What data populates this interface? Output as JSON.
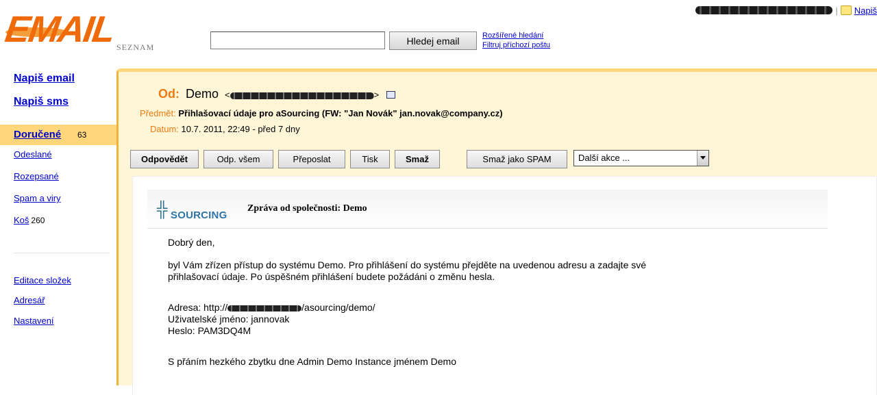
{
  "header": {
    "logo_text": "EMAIL",
    "logo_sub": "SEZNAM",
    "search_placeholder": "",
    "search_button": "Hledej email",
    "advanced_search": "Rozšířené hledání",
    "filter_incoming": "Filtruj příchozí poštu",
    "user_email": "",
    "write_link": "Napiš"
  },
  "sidebar": {
    "compose_email": "Napiš email",
    "compose_sms": "Napiš sms",
    "folders": [
      {
        "name": "Doručené",
        "count": "63"
      },
      {
        "name": "Odeslané",
        "count": ""
      },
      {
        "name": "Rozepsané",
        "count": ""
      },
      {
        "name": "Spam a viry",
        "count": ""
      },
      {
        "name": "Koš",
        "count": "260"
      }
    ],
    "tools": [
      "Editace složek",
      "Adresář",
      "Nastavení"
    ]
  },
  "message": {
    "from_label": "Od:",
    "from_name": "Demo",
    "subject_label": "Předmět:",
    "subject": "Přihlašovací údaje pro aSourcing (FW: \"Jan Novák\" jan.novak@company.cz)",
    "date_label": "Datum:",
    "date": "10.7. 2011, 22:49 - před 7 dny"
  },
  "actions": {
    "reply": "Odpovědět",
    "reply_all": "Odp. všem",
    "forward": "Přeposlat",
    "print": "Tisk",
    "delete": "Smaž",
    "delete_spam": "Smaž jako SPAM",
    "more_actions": "Další akce ..."
  },
  "content": {
    "brand": "SOURCING",
    "company_title": "Zpráva od společnosti: Demo",
    "greeting": "Dobrý den,",
    "para1_line1": "byl Vám zřízen přístup do systému Demo. Pro přihlášení do systému přejděte na uvedenou adresu a zadajte své",
    "para1_line2": "přihlašovací údaje. Po úspěšném přihlášení budete požádáni o změnu hesla.",
    "address_prefix": "Adresa: http://",
    "address_suffix": "/asourcing/demo/",
    "username": "Uživatelské jméno: jannovak",
    "password": "Heslo: PAM3DQ4M",
    "closing": "S přáním hezkého zbytku dne Admin Demo Instance jménem Demo"
  }
}
